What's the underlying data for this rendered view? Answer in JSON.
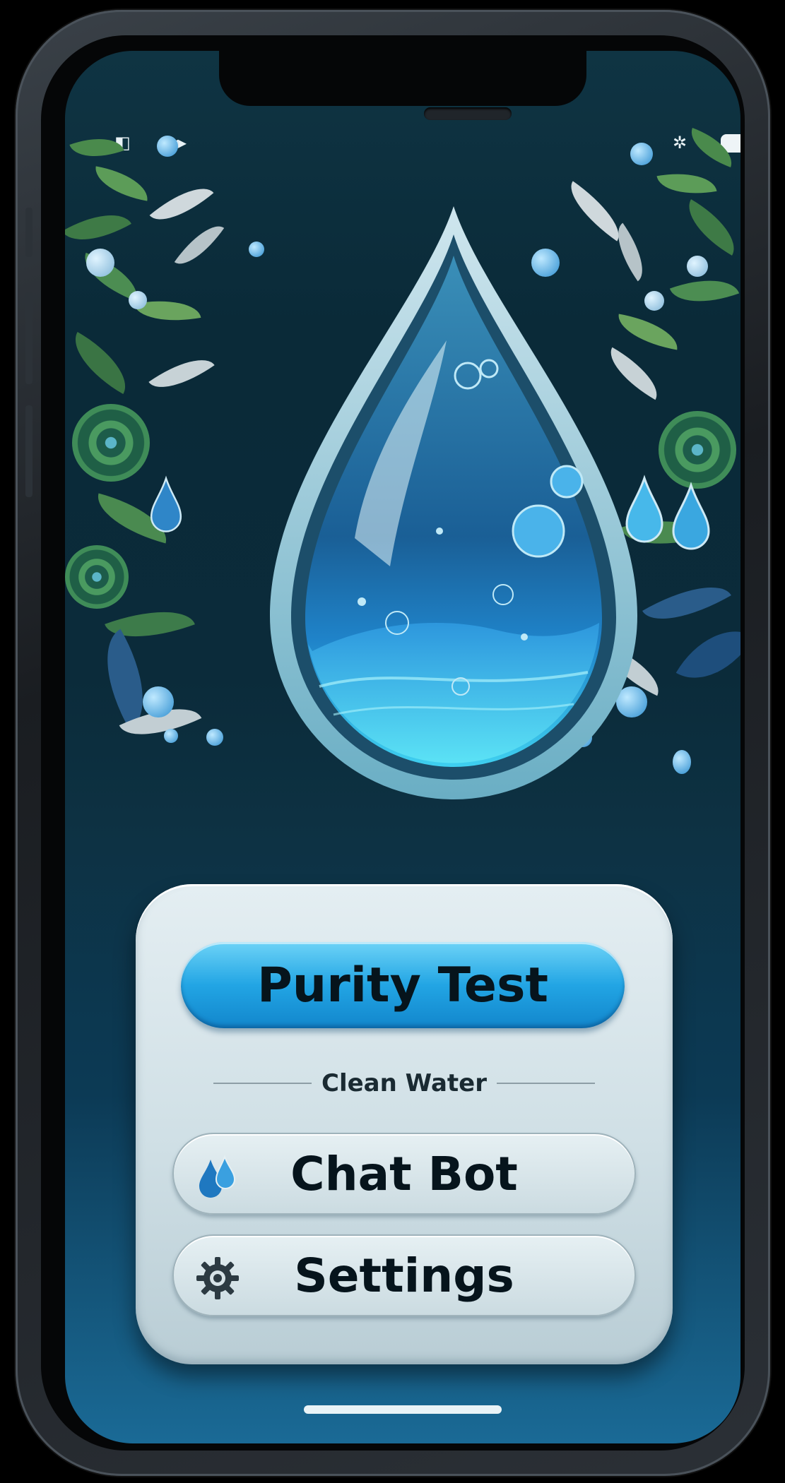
{
  "app": {
    "name": "Clean Water"
  },
  "status_bar": {
    "left_icons": [
      "notification-icon",
      "data-icon"
    ],
    "right_icons": [
      "settings-status-icon",
      "battery-icon"
    ]
  },
  "hero": {
    "image": "water-drop-illustration"
  },
  "menu": {
    "primary_button_label": "Purity Test",
    "divider_label": "Clean Water",
    "items": [
      {
        "label": "Chat Bot",
        "icon": "water-drops-icon"
      },
      {
        "label": "Settings",
        "icon": "gear-icon"
      }
    ]
  },
  "colors": {
    "background_dark": "#0b2b3a",
    "accent": "#22a5e4",
    "card": "#d6e4ea",
    "text": "#06141c"
  }
}
